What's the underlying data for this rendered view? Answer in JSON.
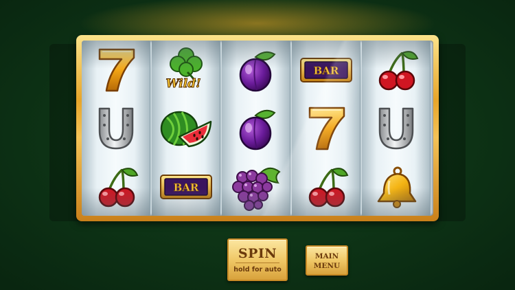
{
  "slot": {
    "reels": [
      [
        "seven",
        "horseshoe",
        "cherry"
      ],
      [
        "clover-wild",
        "watermelon",
        "bar"
      ],
      [
        "plum",
        "plum",
        "grapes"
      ],
      [
        "bar",
        "seven",
        "cherry"
      ],
      [
        "cherry",
        "horseshoe",
        "bell"
      ]
    ],
    "wild_label": "Wild!",
    "bar_label": "BAR"
  },
  "controls": {
    "spin_label": "SPIN",
    "spin_sublabel": "hold for auto",
    "menu_line1": "MAIN",
    "menu_line2": "MENU"
  },
  "colors": {
    "table_green": "#0d3215",
    "frame_gold": "#e7a52a",
    "button_gold": "#f0c867",
    "button_text": "#6b3a0c"
  }
}
